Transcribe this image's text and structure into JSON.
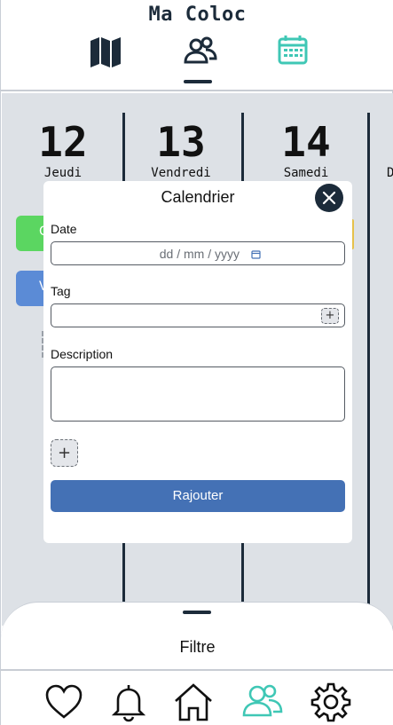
{
  "app": {
    "title": "Ma Coloc"
  },
  "header": {
    "icons": [
      {
        "name": "map-icon",
        "active": false
      },
      {
        "name": "users-icon",
        "active": true
      },
      {
        "name": "calendar-icon",
        "active": false
      }
    ]
  },
  "calendar": {
    "days": [
      {
        "number": "12",
        "name": "Jeudi"
      },
      {
        "number": "13",
        "name": "Vendredi"
      },
      {
        "number": "14",
        "name": "Samedi"
      },
      {
        "number": "",
        "name": "D"
      }
    ],
    "events": [
      {
        "label": "C",
        "color": "#5bd661"
      },
      {
        "label": "V",
        "color": "#5b8bd6"
      }
    ]
  },
  "modal": {
    "title": "Calendrier",
    "date_label": "Date",
    "date_placeholder": "dd / mm / yyyy",
    "tag_label": "Tag",
    "tag_add": "+",
    "description_label": "Description",
    "add_symbol": "+",
    "submit_label": "Rajouter"
  },
  "sheet": {
    "label": "Filtre"
  },
  "nav": {
    "items": [
      {
        "name": "heart-icon"
      },
      {
        "name": "bell-icon"
      },
      {
        "name": "home-icon"
      },
      {
        "name": "users-icon",
        "active": true
      },
      {
        "name": "gear-icon"
      }
    ]
  },
  "colors": {
    "accent": "#3fc7b5",
    "dark": "#1c2b3a",
    "primary_button": "#4471b5",
    "background": "#dde1e6"
  }
}
